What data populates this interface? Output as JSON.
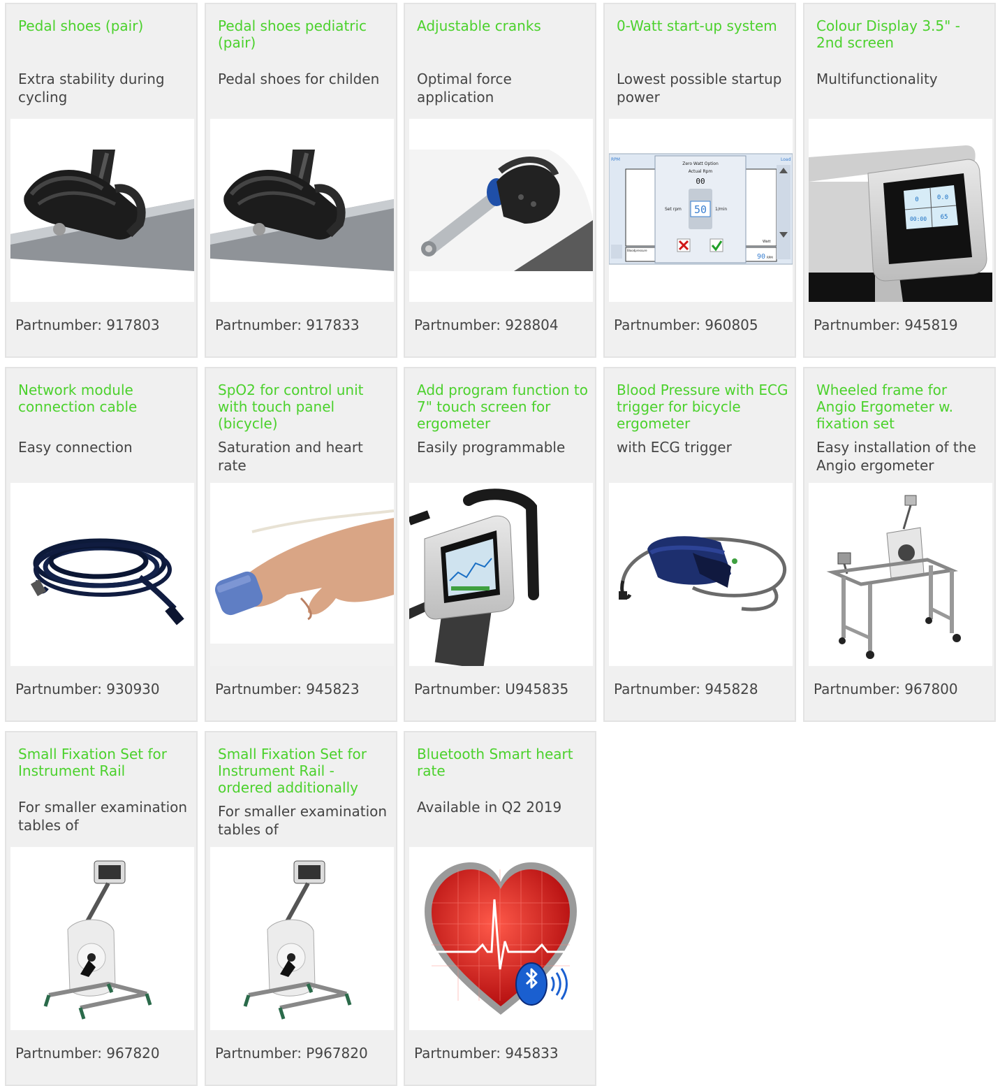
{
  "cards": [
    {
      "title": "Pedal shoes (pair)",
      "description": "Extra stability during cycling",
      "partnumber": "Partnumber: 917803",
      "icon": "pedal-shoe-icon"
    },
    {
      "title": "Pedal shoes pediatric (pair)",
      "description": "Pedal shoes for childen",
      "partnumber": "Partnumber: 917833",
      "icon": "pedal-shoe-icon"
    },
    {
      "title": "Adjustable cranks",
      "description": "Optimal force application",
      "partnumber": "Partnumber: 928804",
      "icon": "crank-icon"
    },
    {
      "title": "0-Watt start-up system",
      "description": "Lowest possible startup power",
      "partnumber": "Partnumber: 960805",
      "icon": "zero-watt-screen-icon",
      "screen": {
        "rpm": "RPM",
        "load": "Load",
        "header": "Zero Watt Option",
        "actual_rpm": "Actual Rpm",
        "actual_value": "00",
        "set_rpm": "Set rpm",
        "set_value": "50",
        "unit": "1/min",
        "watt": "Watt",
        "bottom_value": "90",
        "bottom_unit": "RPM",
        "bloodpressure": "Bloodpressure"
      }
    },
    {
      "title": "Colour Display 3.5\" - 2nd screen",
      "description": "Multifunctionality",
      "partnumber": "Partnumber: 945819",
      "icon": "colour-display-icon",
      "screen": {
        "v1": "0",
        "v2": "0.0",
        "v3": "00:00",
        "v4": "65"
      }
    },
    {
      "title": "Network module connection cable",
      "description": "Easy connection",
      "partnumber": "Partnumber: 930930",
      "icon": "network-cable-icon"
    },
    {
      "title": "SpO2 for control unit with touch panel (bicycle)",
      "description": "Saturation and heart rate",
      "partnumber": "Partnumber: 945823",
      "icon": "pulse-oximeter-icon"
    },
    {
      "title": "Add program function to 7\" touch screen for ergometer",
      "description": "Easily programmable",
      "partnumber": "Partnumber: U945835",
      "icon": "touch-screen-icon"
    },
    {
      "title": "Blood Pressure with ECG trigger for bicycle ergometer",
      "description": "with ECG trigger",
      "partnumber": "Partnumber: 945828",
      "icon": "blood-pressure-cuff-icon"
    },
    {
      "title": "Wheeled frame for Angio Ergometer w. fixation set",
      "description": "Easy installation of the Angio ergometer",
      "partnumber": "Partnumber: 967800",
      "icon": "wheeled-frame-icon"
    },
    {
      "title": "Small Fixation Set for Instrument Rail",
      "description": "For smaller examination tables of",
      "partnumber": "Partnumber: 967820",
      "icon": "angio-ergometer-icon"
    },
    {
      "title": "Small Fixation Set for Instrument Rail - ordered additionally",
      "description": "For smaller examination tables of",
      "partnumber": "Partnumber: P967820",
      "icon": "angio-ergometer-icon"
    },
    {
      "title": "Bluetooth Smart heart rate",
      "description": "Available in Q2 2019",
      "partnumber": "Partnumber: 945833",
      "icon": "bluetooth-heart-icon"
    }
  ],
  "colors": {
    "title": "#4bd12c",
    "text": "#444444",
    "card_bg": "#f0f0f0",
    "card_border": "#e3e3e3"
  }
}
